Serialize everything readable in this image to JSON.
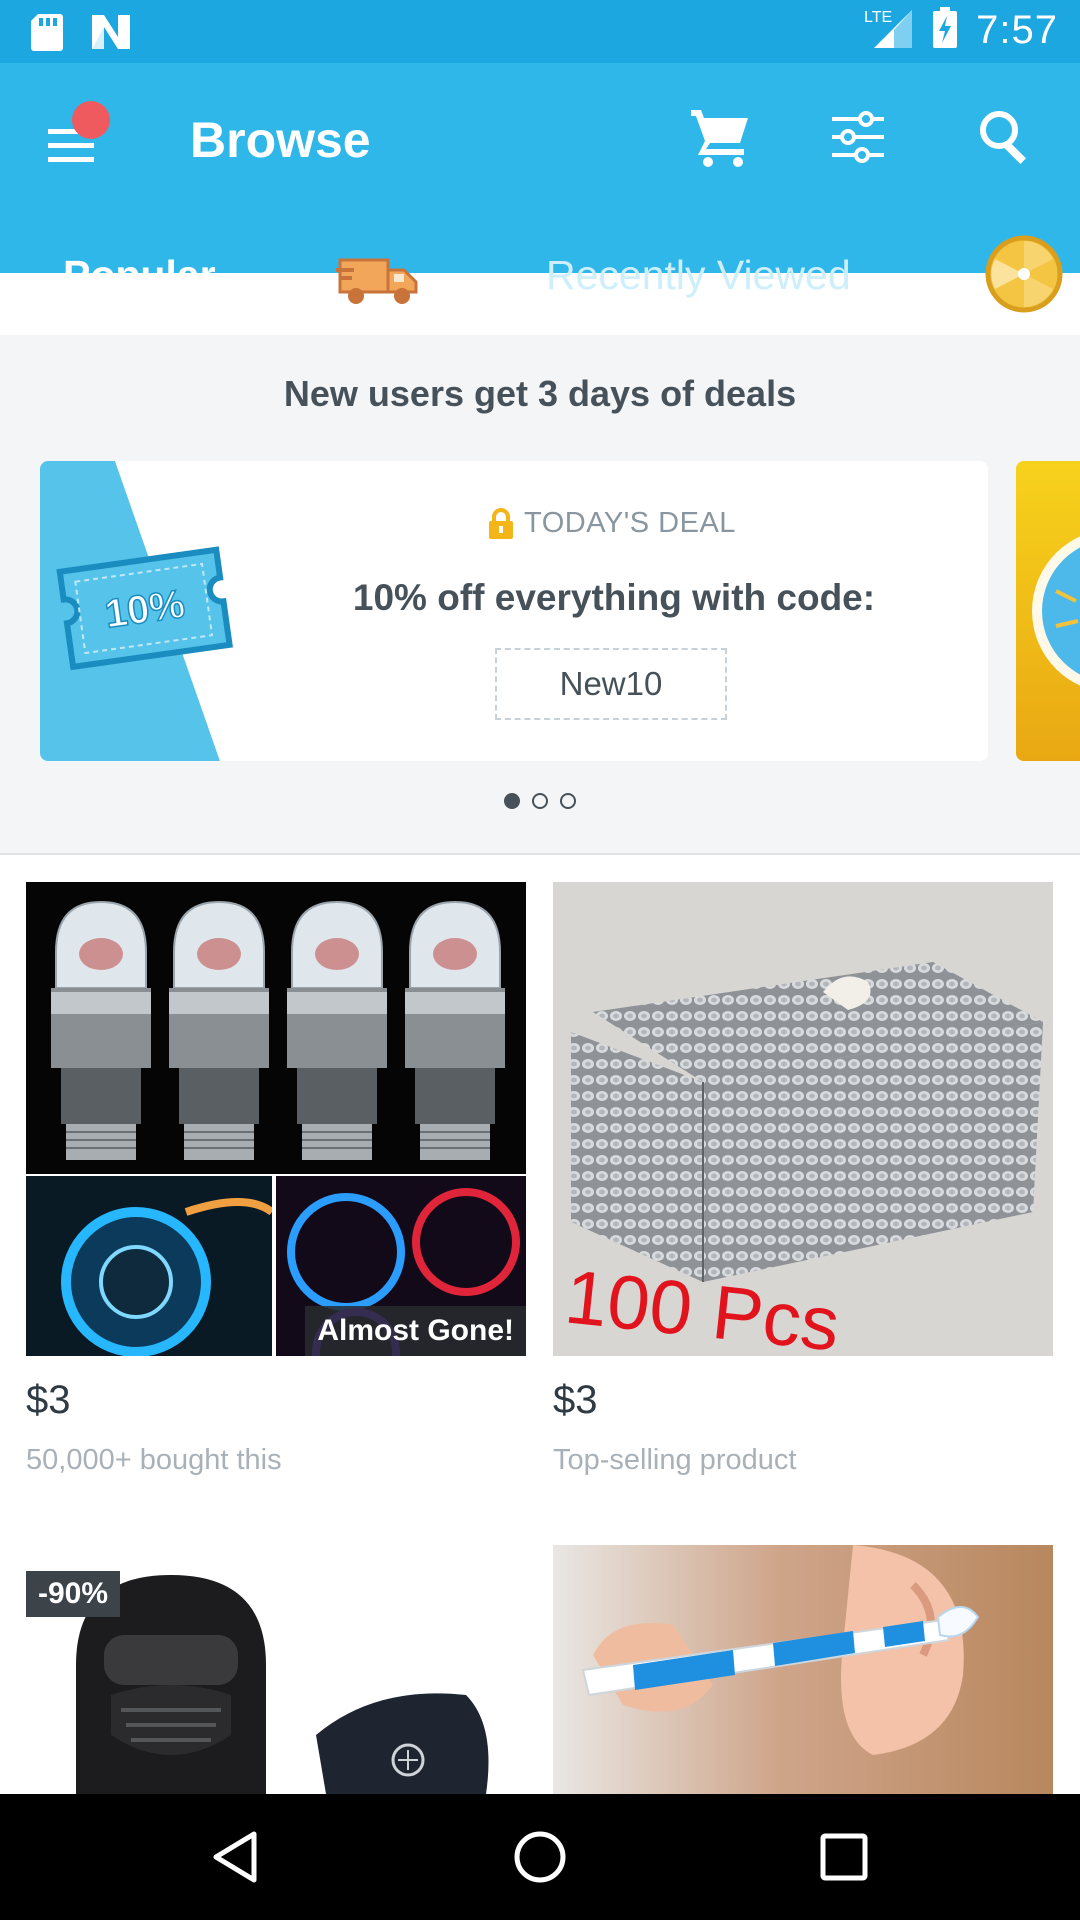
{
  "status_bar": {
    "time": "7:57",
    "network": "LTE",
    "icons": [
      "sd-card-icon",
      "n-notification-icon",
      "signal-icon",
      "battery-charging-icon"
    ]
  },
  "app_bar": {
    "title": "Browse",
    "icons": [
      "menu-icon",
      "cart-icon",
      "filter-icon",
      "search-icon"
    ],
    "notification_dot_color": "#ef5a5f",
    "background": "#2fb7ea"
  },
  "tabs": [
    {
      "label": "Popular",
      "selected": true
    },
    {
      "label": "",
      "icon": "delivery-truck-icon",
      "selected": false
    },
    {
      "label": "Recently Viewed",
      "selected": false
    },
    {
      "label": "",
      "icon": "prize-wheel-icon",
      "selected": false
    }
  ],
  "deals": {
    "heading": "New users get 3 days of deals",
    "card": {
      "tag": "TODAY'S DEAL",
      "coupon_text": "10%",
      "text": "10% off everything with code:",
      "code": "New10"
    },
    "page_count": 3,
    "active_page": 1
  },
  "products": [
    {
      "price": "$3",
      "subtitle": "50,000+ bought this",
      "badge": "Almost Gone!",
      "image": "led-valve-caps"
    },
    {
      "price": "$3",
      "subtitle": "Top-selling product",
      "overlay_text": "100 Pcs",
      "image": "magnet-cube"
    },
    {
      "price": "",
      "subtitle": "",
      "badge": "-90%",
      "image": "balaclava-masks"
    },
    {
      "price": "",
      "subtitle": "",
      "image": "ear-wax-remover"
    }
  ],
  "nav_bar": {
    "icons": [
      "back-icon",
      "home-icon",
      "recents-icon"
    ]
  }
}
